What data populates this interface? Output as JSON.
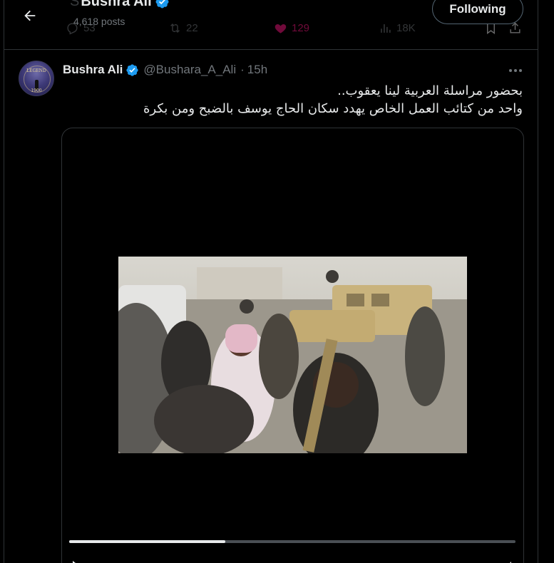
{
  "header": {
    "back_label": "Back",
    "ghost_prefix": "S",
    "title": "Bushra Ali",
    "post_count": "4,618 posts",
    "follow_label": "Following",
    "ghost_actions": {
      "replies": "53",
      "reposts": "22",
      "likes": "129",
      "views": "18K"
    }
  },
  "tweet": {
    "author_name": "Bushra Ali",
    "handle": "@Bushara_A_Ali",
    "separator": "·",
    "time": "15h",
    "avatar_text": [
      "LEGEND",
      "1900"
    ],
    "lines": [
      "بحضور مراسلة العربية  لينا  يعقوب..",
      "واحد من كتائب العمل الخاص يهدد سكان الحاج يوسف بالضبح ومن بكرة"
    ]
  },
  "video": {
    "progress": 0.35
  },
  "colors": {
    "accent": "#1d9bf0",
    "like": "#f91880",
    "muted": "#71767b",
    "border": "#2f3336"
  },
  "icons": {
    "back": "arrow-left-icon",
    "verified": "verified-badge-icon",
    "more": "more-dots-icon"
  }
}
